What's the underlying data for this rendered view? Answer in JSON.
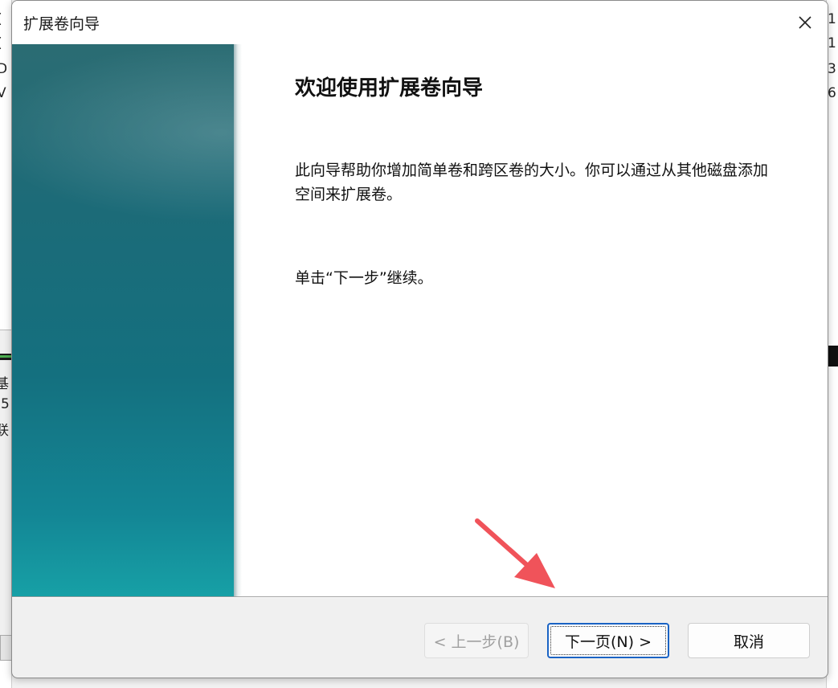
{
  "background": {
    "left_fragments": [
      "(",
      "(",
      "D",
      "V"
    ],
    "left_lower_fragments": [
      "基",
      "5",
      "联"
    ],
    "right_fragments": [
      "1",
      "1",
      "3",
      "6"
    ]
  },
  "dialog": {
    "title": "扩展卷向导",
    "heading": "欢迎使用扩展卷向导",
    "description": "此向导帮助你增加简单卷和跨区卷的大小。你可以通过从其他磁盘添加空间来扩展卷。",
    "hint": "单击“下一步”继续。",
    "buttons": {
      "back": "< 上一步(B)",
      "next": "下一页(N) >",
      "cancel": "取消"
    }
  },
  "colors": {
    "banner_top": "#2b6c73",
    "banner_bottom": "#17a0a6",
    "focus_border": "#1a63c4",
    "annotation_arrow": "#f0535a"
  },
  "icons": {
    "close": "close-icon",
    "annotation": "red-arrow-icon"
  }
}
